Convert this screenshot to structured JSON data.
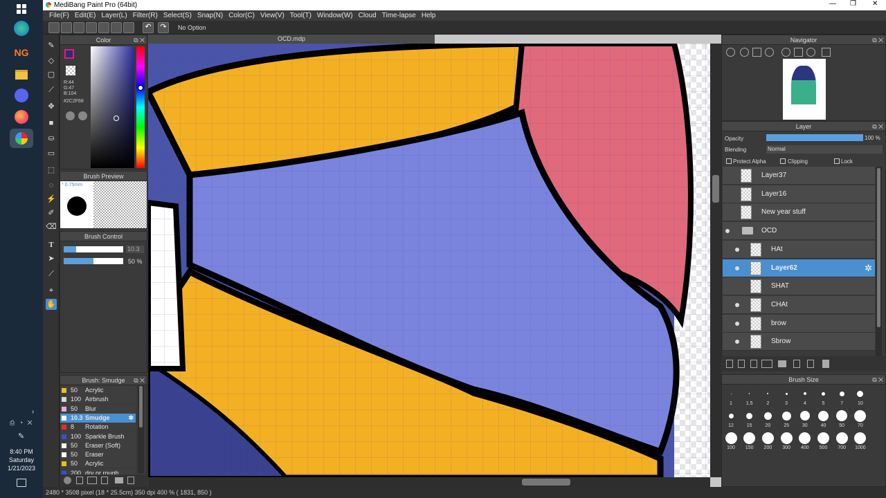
{
  "window": {
    "title": "MediBang Paint Pro (64bit)"
  },
  "menu": [
    "File(F)",
    "Edit(E)",
    "Layer(L)",
    "Filter(R)",
    "Select(S)",
    "Snap(N)",
    "Color(C)",
    "View(V)",
    "Tool(T)",
    "Window(W)",
    "Cloud",
    "Time-lapse",
    "Help"
  ],
  "toolbar": {
    "option_label": "No Option"
  },
  "document": {
    "tab": "OCD.mdp"
  },
  "color_panel": {
    "title": "Color",
    "r": "R:44",
    "g": "G:47",
    "b": "B:104",
    "hex": "#2C2F68",
    "fg": "#2c2f68",
    "accent": "#e8178a"
  },
  "brush_preview": {
    "title": "Brush Preview",
    "size": "* 0.75mm"
  },
  "brush_control": {
    "title": "Brush Control",
    "size_value": "10.3",
    "opacity_value": "50 %"
  },
  "brush_list": {
    "title": "Brush: Smudge",
    "items": [
      {
        "size": "50",
        "name": "Acrylic",
        "color": "#e8c21a"
      },
      {
        "size": "100",
        "name": "Airbrush",
        "color": "#d8d8d8"
      },
      {
        "size": "50",
        "name": "Blur",
        "color": "#f0a8e0"
      },
      {
        "size": "10.3",
        "name": "Smudge",
        "color": "#ffffff",
        "selected": true
      },
      {
        "size": "8",
        "name": "Rotation Symmetry",
        "color": "#e03030"
      },
      {
        "size": "100",
        "name": "Sparkle Brush",
        "color": "#3050e0"
      },
      {
        "size": "50",
        "name": "Eraser (Soft)",
        "color": "#ffffff"
      },
      {
        "size": "50",
        "name": "Eraser",
        "color": "#ffffff"
      },
      {
        "size": "50",
        "name": "Acrylic",
        "color": "#e8c21a"
      },
      {
        "size": "200",
        "name": "dry or rough feeling",
        "color": "#3050e0"
      }
    ]
  },
  "navigator": {
    "title": "Navigator"
  },
  "layer_panel": {
    "title": "Layer",
    "opacity_label": "Opacity",
    "opacity_value": "100 %",
    "opacity_fraction": 1.0,
    "blending_label": "Blending",
    "blending_value": "Normal",
    "protect_alpha": "Protect Alpha",
    "clipping": "Clipping",
    "lock": "Lock"
  },
  "layers": [
    {
      "name": "Layer37",
      "visible": false,
      "indent": 0,
      "folder": false
    },
    {
      "name": "Layer16",
      "visible": false,
      "indent": 0,
      "folder": false
    },
    {
      "name": "New year stuff",
      "visible": false,
      "indent": 0,
      "folder": false
    },
    {
      "name": "OCD",
      "visible": true,
      "indent": 0,
      "folder": true
    },
    {
      "name": "HAt",
      "visible": true,
      "indent": 1,
      "folder": false
    },
    {
      "name": "Layer62",
      "visible": true,
      "indent": 1,
      "folder": false,
      "selected": true
    },
    {
      "name": "SHAT",
      "visible": false,
      "indent": 1,
      "folder": false
    },
    {
      "name": "CHAt",
      "visible": true,
      "indent": 1,
      "folder": false
    },
    {
      "name": "brow",
      "visible": true,
      "indent": 1,
      "folder": false
    },
    {
      "name": "Sbrow",
      "visible": true,
      "indent": 1,
      "folder": false
    }
  ],
  "brush_size": {
    "title": "Brush Size",
    "sizes": [
      "1",
      "1.5",
      "2",
      "3",
      "4",
      "5",
      "7",
      "10",
      "12",
      "15",
      "20",
      "25",
      "30",
      "40",
      "50",
      "70",
      "100",
      "150",
      "200",
      "300",
      "400",
      "500",
      "700",
      "1000"
    ]
  },
  "status": {
    "text": "2480 * 3508 pixel  (18 * 25.5cm)  350 dpi  400 %  ( 1831, 850 )"
  },
  "clock": {
    "time": "8:40 PM",
    "day": "Saturday",
    "date": "1/21/2023"
  },
  "taskbar": {
    "ng_label": "NG"
  }
}
